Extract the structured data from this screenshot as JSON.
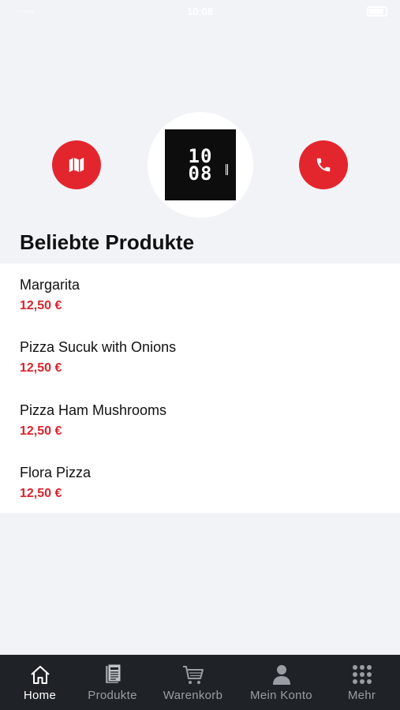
{
  "status_bar": {
    "carrier": "·····",
    "time": "10:08"
  },
  "header": {
    "map_button_icon": "map-icon",
    "phone_button_icon": "phone-icon",
    "logo": {
      "line1": "10",
      "line2": "08"
    }
  },
  "section_title": "Beliebte Produkte",
  "products": [
    {
      "name": "Margarita",
      "price": "12,50 €"
    },
    {
      "name": "Pizza Sucuk with Onions",
      "price": "12,50 €"
    },
    {
      "name": "Pizza Ham Mushrooms",
      "price": "12,50 €"
    },
    {
      "name": "Flora Pizza",
      "price": "12,50 €"
    }
  ],
  "tabs": [
    {
      "label": "Home",
      "icon": "home-icon",
      "active": true
    },
    {
      "label": "Produkte",
      "icon": "menu-card-icon",
      "active": false
    },
    {
      "label": "Warenkorb",
      "icon": "cart-icon",
      "active": false
    },
    {
      "label": "Mein Konto",
      "icon": "user-icon",
      "active": false
    },
    {
      "label": "Mehr",
      "icon": "grid-icon",
      "active": false
    }
  ],
  "colors": {
    "accent": "#e3262e",
    "price": "#d9242d",
    "tab_bar": "#1f2327",
    "background": "#f2f3f7"
  }
}
